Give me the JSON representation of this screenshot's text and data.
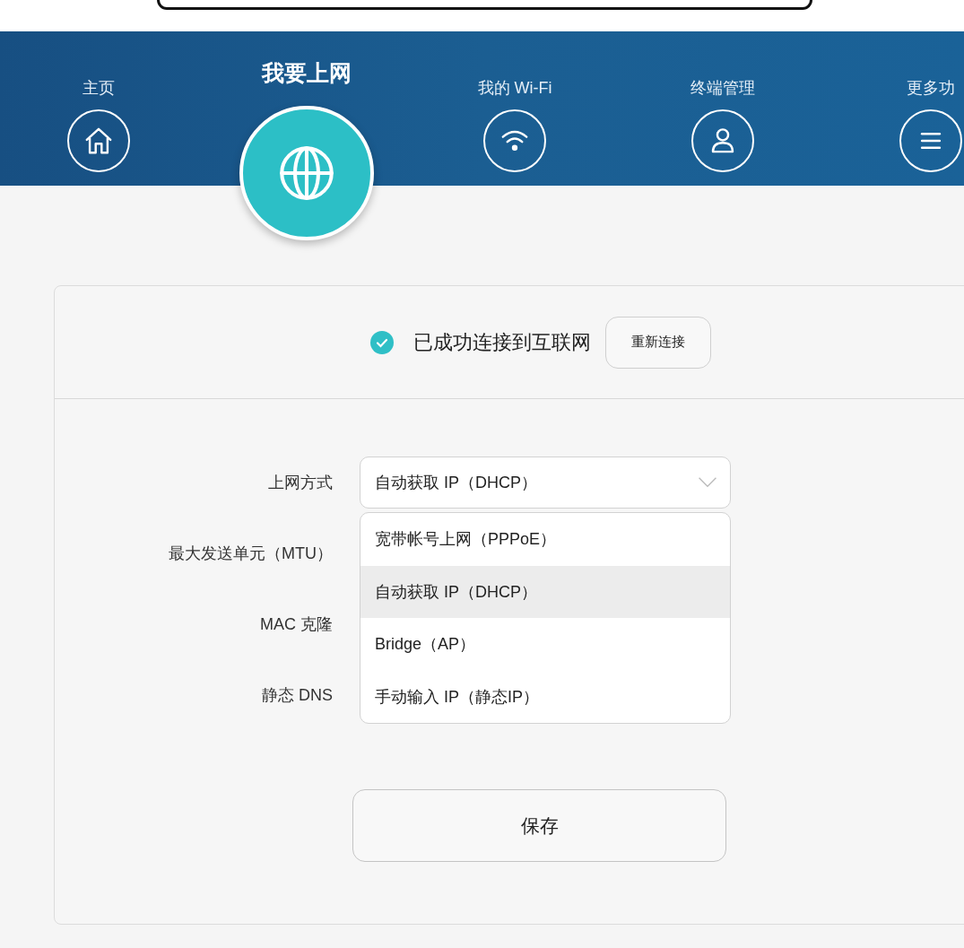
{
  "tabs": [
    {
      "label": "主页",
      "selected": false
    },
    {
      "label": "我要上网",
      "selected": true
    },
    {
      "label": "我的 Wi-Fi",
      "selected": false
    },
    {
      "label": "终端管理",
      "selected": false
    },
    {
      "label": "更多功",
      "selected": false
    }
  ],
  "status": {
    "connected": true,
    "message": "已成功连接到互联网",
    "reconnect_button": "重新连接"
  },
  "form": {
    "fields": [
      {
        "label": "上网方式",
        "value": "自动获取 IP（DHCP）"
      },
      {
        "label": "最大发送单元（MTU）"
      },
      {
        "label": "MAC 克隆"
      },
      {
        "label": "静态 DNS"
      }
    ]
  },
  "dropdown": {
    "open": true,
    "options": [
      {
        "label": "宽带帐号上网（PPPoE）",
        "selected": false
      },
      {
        "label": "自动获取 IP（DHCP）",
        "selected": true
      },
      {
        "label": "Bridge（AP）",
        "selected": false
      },
      {
        "label": "手动输入 IP（静态IP）",
        "selected": false
      }
    ]
  },
  "save_button": "保存"
}
